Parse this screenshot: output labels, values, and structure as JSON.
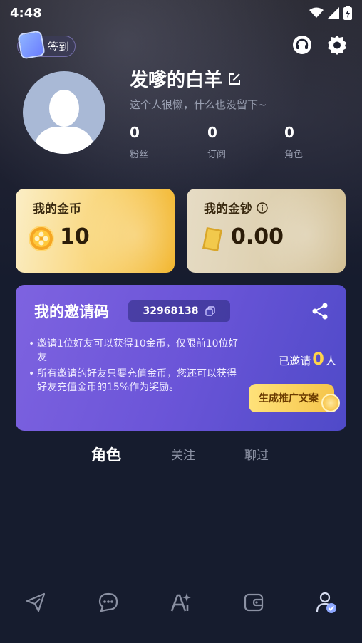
{
  "status_bar": {
    "time": "4:48"
  },
  "header": {
    "checkin_label": "签到"
  },
  "profile": {
    "username": "发嗲的白羊",
    "bio": "这个人很懒，什么也没留下~",
    "stats": [
      {
        "value": "0",
        "label": "粉丝"
      },
      {
        "value": "0",
        "label": "订阅"
      },
      {
        "value": "0",
        "label": "角色"
      }
    ]
  },
  "wallet": {
    "coins": {
      "title": "我的金币",
      "value": "10"
    },
    "cash": {
      "title": "我的金钞",
      "value": "0.00"
    }
  },
  "invite": {
    "title": "我的邀请码",
    "code": "32968138",
    "rules": [
      "邀请1位好友可以获得10金币，仅限前10位好友",
      "所有邀请的好友只要充值金币，您还可以获得好友充值金币的15%作为奖励。"
    ],
    "invited_prefix": "已邀请",
    "invited_count": "0",
    "invited_suffix": "人",
    "generate_button": "生成推广文案"
  },
  "tabs": [
    {
      "label": "角色",
      "active": true
    },
    {
      "label": "关注",
      "active": false
    },
    {
      "label": "聊过",
      "active": false
    }
  ],
  "bottom_nav": {
    "icons": [
      "send-icon",
      "chat-icon",
      "ai-create-icon",
      "wallet-icon",
      "profile-icon"
    ],
    "active": "profile-icon"
  },
  "colors": {
    "background": "#161c2e",
    "invite_gradient_start": "#7e63e0",
    "invite_gradient_end": "#4f4ac8",
    "gold_card": "#f9d578",
    "cash_card": "#ddcfae",
    "accent_yellow": "#ffd44a",
    "active_nav": "#8ea8ff"
  }
}
